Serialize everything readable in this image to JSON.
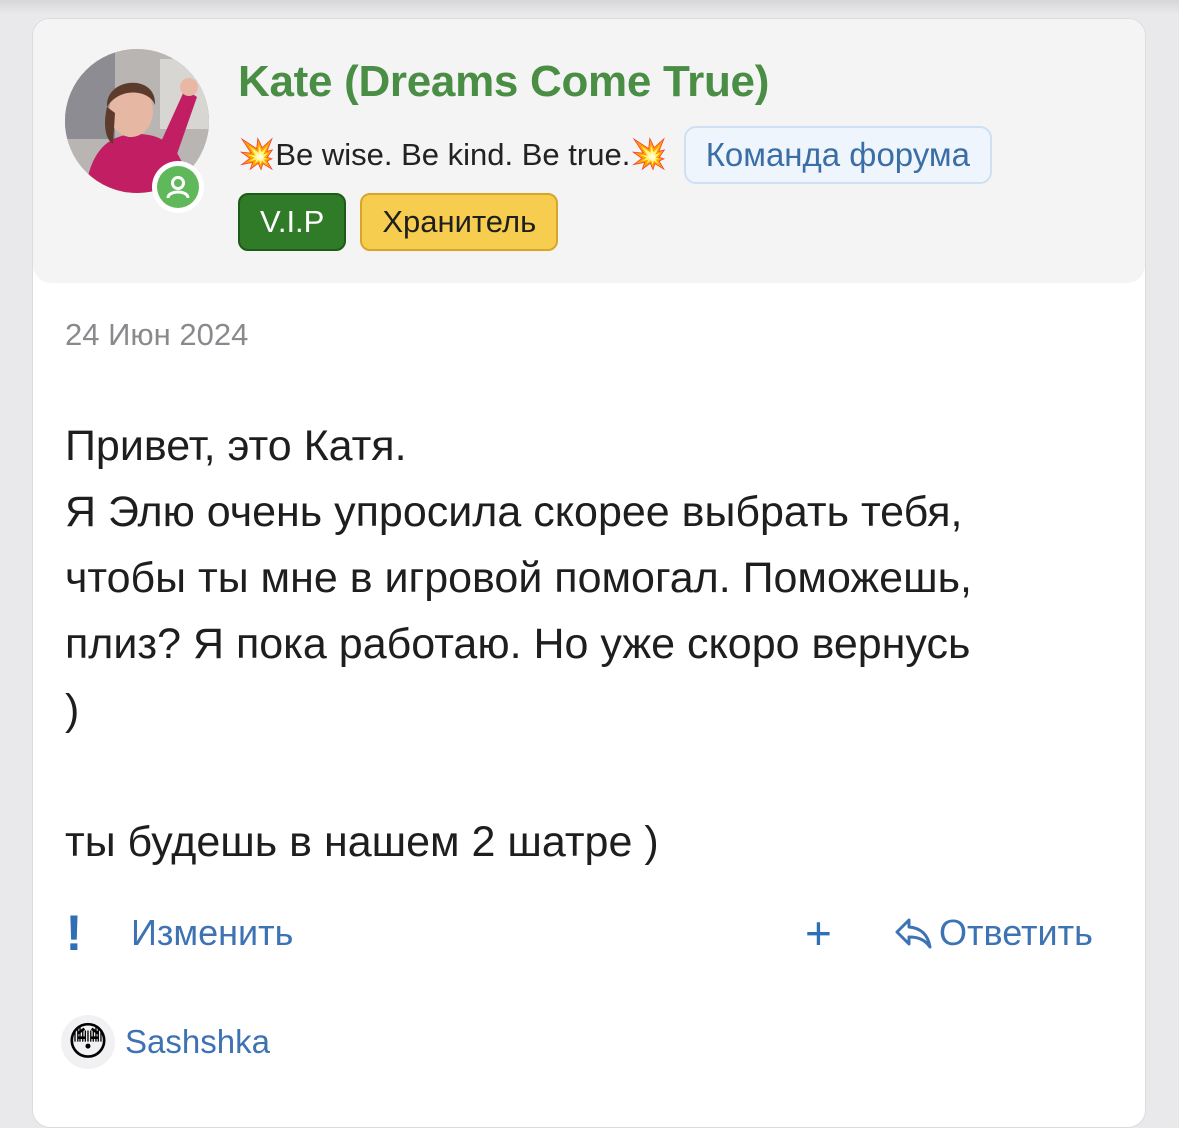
{
  "post": {
    "author": {
      "name": "Kate (Dreams Come True)",
      "title_prefix_icon": "💥",
      "title": "Be wise. Be kind. Be true.",
      "title_suffix_icon": "💥",
      "status": "online",
      "staff_badge": "Команда форума",
      "badges": [
        "V.I.P",
        "Хранитель"
      ]
    },
    "date": "24 Июн 2024",
    "body_lines": [
      "Привет, это Катя.",
      "Я Элю очень упросила скорее выбрать тебя,",
      "чтобы ты мне в игровой помогал. Поможешь,",
      "плиз? Я пока работаю. Но уже скоро вернусь",
      ")",
      "",
      "ты будешь в нашем 2 шатре )"
    ],
    "actions": {
      "report_icon": "!",
      "edit_label": "Изменить",
      "plus_icon": "+",
      "reply_label": "Ответить"
    },
    "reaction": {
      "emoji": "😳",
      "user": "Sashshka"
    }
  },
  "colors": {
    "username": "#4a8d44",
    "link": "#3d72b3",
    "vip_bg": "#2f7b27",
    "keeper_bg": "#f6cd4e",
    "online": "#5fb85a"
  }
}
